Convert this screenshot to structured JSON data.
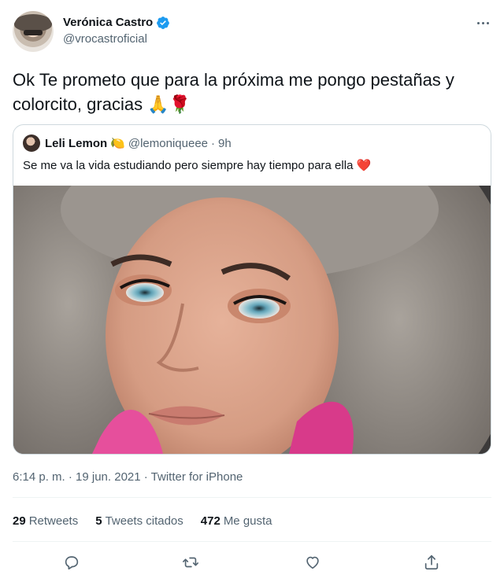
{
  "tweet": {
    "display_name": "Verónica Castro",
    "handle": "@vrocastroficial",
    "text": "Ok Te prometo que para la próxima me pongo pestañas y colorcito, gracias 🙏🌹"
  },
  "quoted": {
    "name": "Leli Lemon",
    "name_emoji": "🍋",
    "handle": "@lemoniqueee",
    "separator": "·",
    "time": "9h",
    "text": "Se me va la vida estudiando pero siempre hay tiempo para ella ❤️"
  },
  "meta": {
    "line": "6:14 p. m. · 19 jun. 2021 · Twitter for iPhone"
  },
  "stats": {
    "retweets_count": "29",
    "retweets_label": "Retweets",
    "quotes_count": "5",
    "quotes_label": "Tweets citados",
    "likes_count": "472",
    "likes_label": "Me gusta"
  },
  "icons": {
    "verified": "verified-badge-icon",
    "more": "more-icon",
    "reply": "reply-icon",
    "retweet": "retweet-icon",
    "like": "like-icon",
    "share": "share-icon"
  },
  "colors": {
    "verified": "#1d9bf0",
    "secondary_text": "#536471",
    "border": "#cfd9de"
  }
}
